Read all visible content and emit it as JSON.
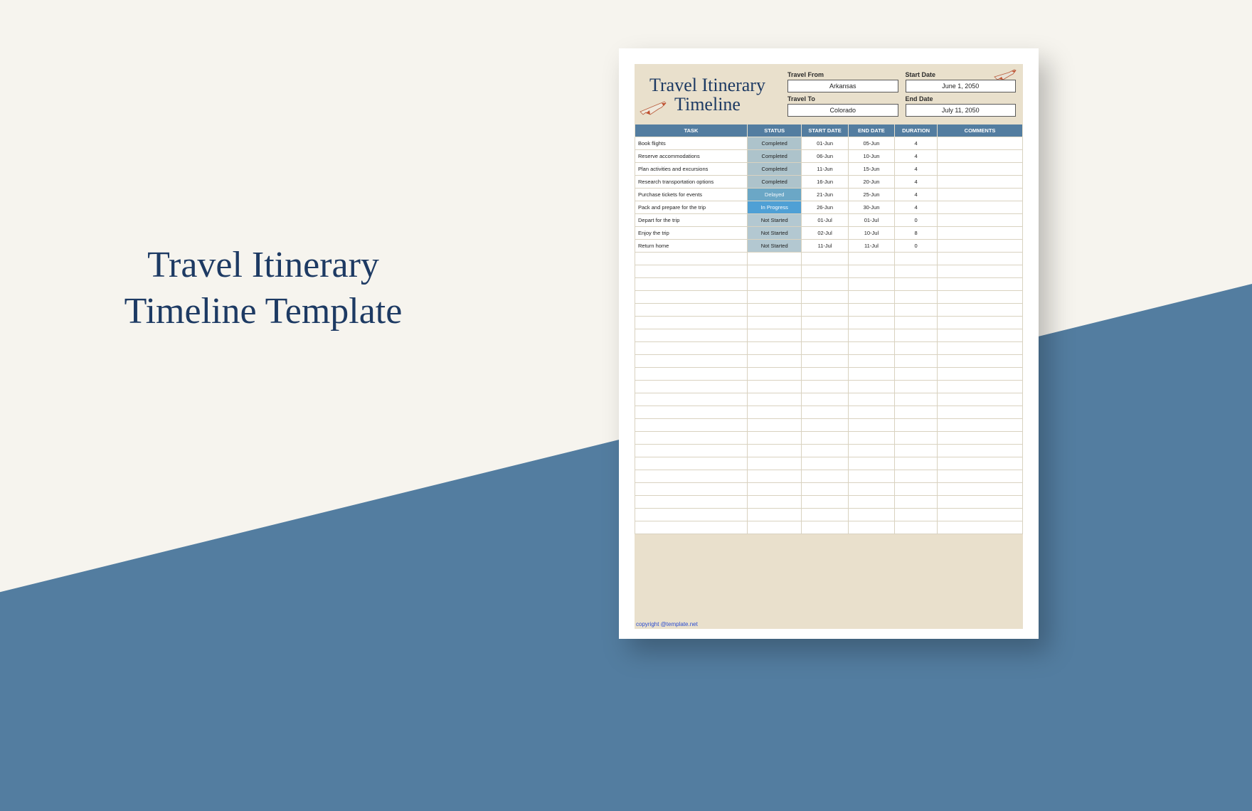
{
  "hero": {
    "title": "Travel Itinerary Timeline Template"
  },
  "doc": {
    "title_line1": "Travel Itinerary",
    "title_line2": "Timeline",
    "meta": {
      "travel_from_label": "Travel From",
      "travel_from_value": "Arkansas",
      "start_date_label": "Start Date",
      "start_date_value": "June 1, 2050",
      "travel_to_label": "Travel To",
      "travel_to_value": "Colorado",
      "end_date_label": "End Date",
      "end_date_value": "July 11, 2050"
    },
    "columns": {
      "task": "TASK",
      "status": "STATUS",
      "start": "START DATE",
      "end": "END DATE",
      "duration": "DURATION",
      "comments": "COMMENTS"
    },
    "rows": [
      {
        "task": "Book flights",
        "status": "Completed",
        "start": "01-Jun",
        "end": "05-Jun",
        "duration": "4",
        "comments": ""
      },
      {
        "task": "Reserve accommodations",
        "status": "Completed",
        "start": "06-Jun",
        "end": "10-Jun",
        "duration": "4",
        "comments": ""
      },
      {
        "task": "Plan activities and excursions",
        "status": "Completed",
        "start": "11-Jun",
        "end": "15-Jun",
        "duration": "4",
        "comments": ""
      },
      {
        "task": "Research transportation options",
        "status": "Completed",
        "start": "16-Jun",
        "end": "20-Jun",
        "duration": "4",
        "comments": ""
      },
      {
        "task": "Purchase tickets for events",
        "status": "Delayed",
        "start": "21-Jun",
        "end": "25-Jun",
        "duration": "4",
        "comments": ""
      },
      {
        "task": "Pack and prepare for the trip",
        "status": "In Progress",
        "start": "26-Jun",
        "end": "30-Jun",
        "duration": "4",
        "comments": ""
      },
      {
        "task": "Depart for the trip",
        "status": "Not Started",
        "start": "01-Jul",
        "end": "01-Jul",
        "duration": "0",
        "comments": ""
      },
      {
        "task": "Enjoy the trip",
        "status": "Not Started",
        "start": "02-Jul",
        "end": "10-Jul",
        "duration": "8",
        "comments": ""
      },
      {
        "task": "Return home",
        "status": "Not Started",
        "start": "11-Jul",
        "end": "11-Jul",
        "duration": "0",
        "comments": ""
      }
    ],
    "empty_rows": 22,
    "footer": "copyright @template.net"
  }
}
